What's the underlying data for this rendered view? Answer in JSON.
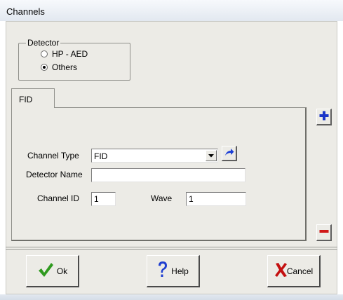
{
  "window": {
    "title": "Channels"
  },
  "detector": {
    "legend": "Detector",
    "options": [
      {
        "label": "HP - AED",
        "checked": false
      },
      {
        "label": "Others",
        "checked": true
      }
    ]
  },
  "tabs": [
    {
      "label": "FID",
      "active": true
    }
  ],
  "form": {
    "channel_type_label": "Channel Type",
    "channel_type_value": "FID",
    "detector_name_label": "Detector Name",
    "detector_name_value": "",
    "channel_id_label": "Channel ID",
    "channel_id_value": "1",
    "wave_label": "Wave",
    "wave_value": "1"
  },
  "side_buttons": {
    "add": "plus-icon",
    "remove": "minus-icon"
  },
  "footer": {
    "ok_label": "Ok",
    "help_label": "Help",
    "cancel_label": "Cancel"
  },
  "colors": {
    "plus": "#1a35c8",
    "minus": "#d01818",
    "check": "#2f9a1f",
    "help": "#1f3fd0",
    "cancel_x": "#c41010",
    "arrow": "#1c3fd6"
  }
}
